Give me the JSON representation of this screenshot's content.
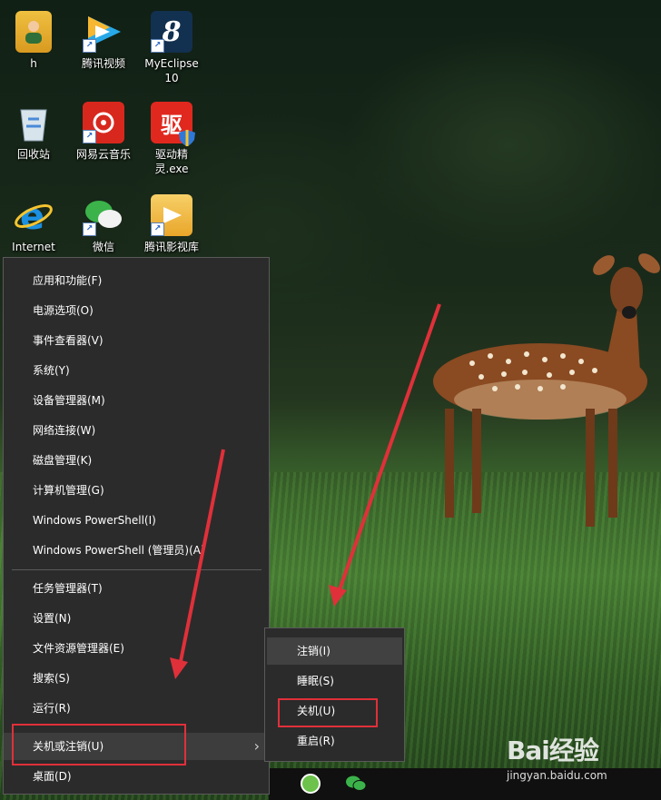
{
  "desktop": {
    "icons": [
      {
        "label": "h",
        "icon": "user-folder-icon"
      },
      {
        "label": "腾讯视频",
        "icon": "tencent-video-icon"
      },
      {
        "label": "MyEclipse",
        "label2": "10",
        "icon": "myeclipse-icon"
      },
      {
        "label": "回收站",
        "icon": "recycle-bin-icon"
      },
      {
        "label": "网易云音乐",
        "icon": "netease-music-icon"
      },
      {
        "label": "驱动精灵.exe",
        "icon": "driver-genius-icon"
      },
      {
        "label": "Internet",
        "icon": "internet-explorer-icon"
      },
      {
        "label": "微信",
        "icon": "wechat-icon"
      },
      {
        "label": "腾讯影视库",
        "icon": "tencent-film-library-icon"
      }
    ]
  },
  "winx_menu": {
    "items": [
      "应用和功能(F)",
      "电源选项(O)",
      "事件查看器(V)",
      "系统(Y)",
      "设备管理器(M)",
      "网络连接(W)",
      "磁盘管理(K)",
      "计算机管理(G)",
      "Windows PowerShell(I)",
      "Windows PowerShell (管理员)(A)",
      "任务管理器(T)",
      "设置(N)",
      "文件资源管理器(E)",
      "搜索(S)",
      "运行(R)",
      "关机或注销(U)",
      "桌面(D)"
    ],
    "arrow": "›"
  },
  "submenu": {
    "items": [
      "注销(I)",
      "睡眠(S)",
      "关机(U)",
      "重启(R)"
    ]
  },
  "watermark": {
    "brand": "Bai经验",
    "site": "jingyan.baidu.com"
  },
  "colors": {
    "menu_bg": "#2b2b2b",
    "highlight": "#e0303a"
  }
}
